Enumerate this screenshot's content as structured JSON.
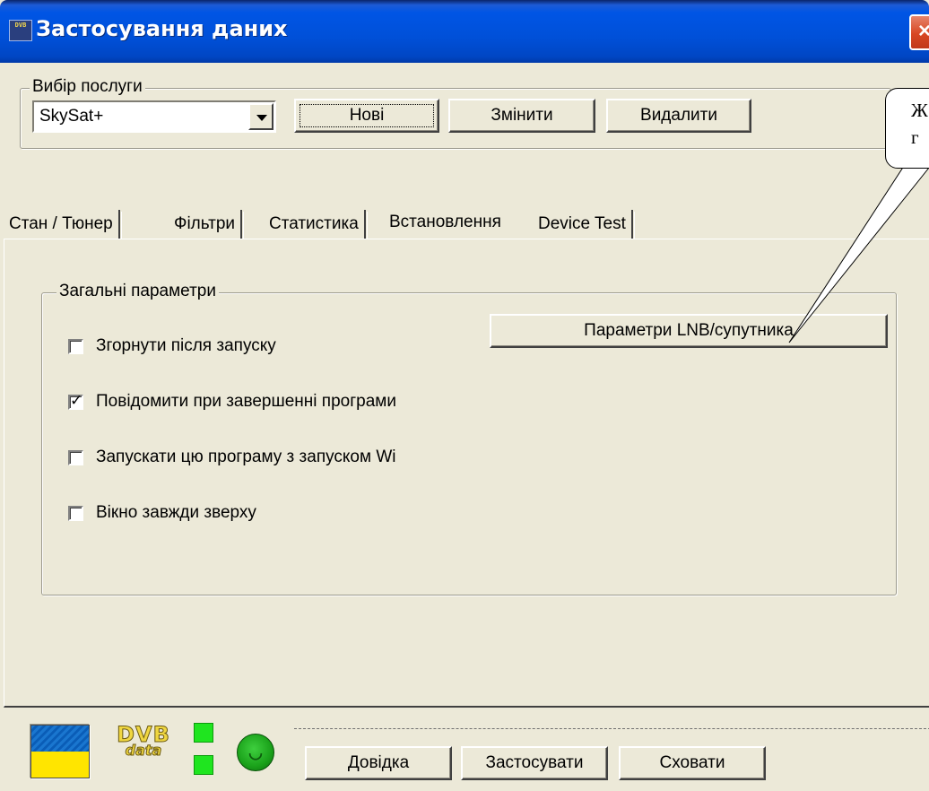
{
  "window": {
    "title": "Застосування даних",
    "app_icon_text": "DVB",
    "close_glyph": "×"
  },
  "service": {
    "legend": "Вибір послуги",
    "selected": "SkySat+",
    "new_label": "Нові",
    "edit_label": "Змінити",
    "delete_label": "Видалити"
  },
  "tabs": [
    {
      "label": "Стан / Тюнер"
    },
    {
      "label": "Фільтри"
    },
    {
      "label": "Статистика"
    },
    {
      "label": "Встановлення",
      "active": true
    },
    {
      "label": "Device Test"
    }
  ],
  "general": {
    "legend": "Загальні параметри",
    "lnb_button": "Параметри LNB/супутника",
    "options": [
      {
        "label": "Згорнути після запуску",
        "checked": false
      },
      {
        "label": "Повідомити при завершенні програми",
        "checked": true
      },
      {
        "label": "Запускати цю програму з запуском Wi",
        "checked": false
      },
      {
        "label": "Вікно завжди зверху",
        "checked": false
      }
    ]
  },
  "callout": {
    "line1": "Ж",
    "line2": "г"
  },
  "footer": {
    "logo_line1": "DVB",
    "logo_line2": "data",
    "help_label": "Довідка",
    "apply_label": "Застосувати",
    "hide_label": "Сховати"
  },
  "colors": {
    "titlebar": "#0055e5",
    "face": "#ece9d8",
    "led": "#1fe51f",
    "flag_blue": "#1a76cf",
    "flag_yellow": "#ffe500"
  },
  "icons": {
    "app": "dvb-app-icon",
    "close": "close-icon",
    "dropdown": "chevron-down-icon",
    "status": "smiley-status-icon"
  }
}
